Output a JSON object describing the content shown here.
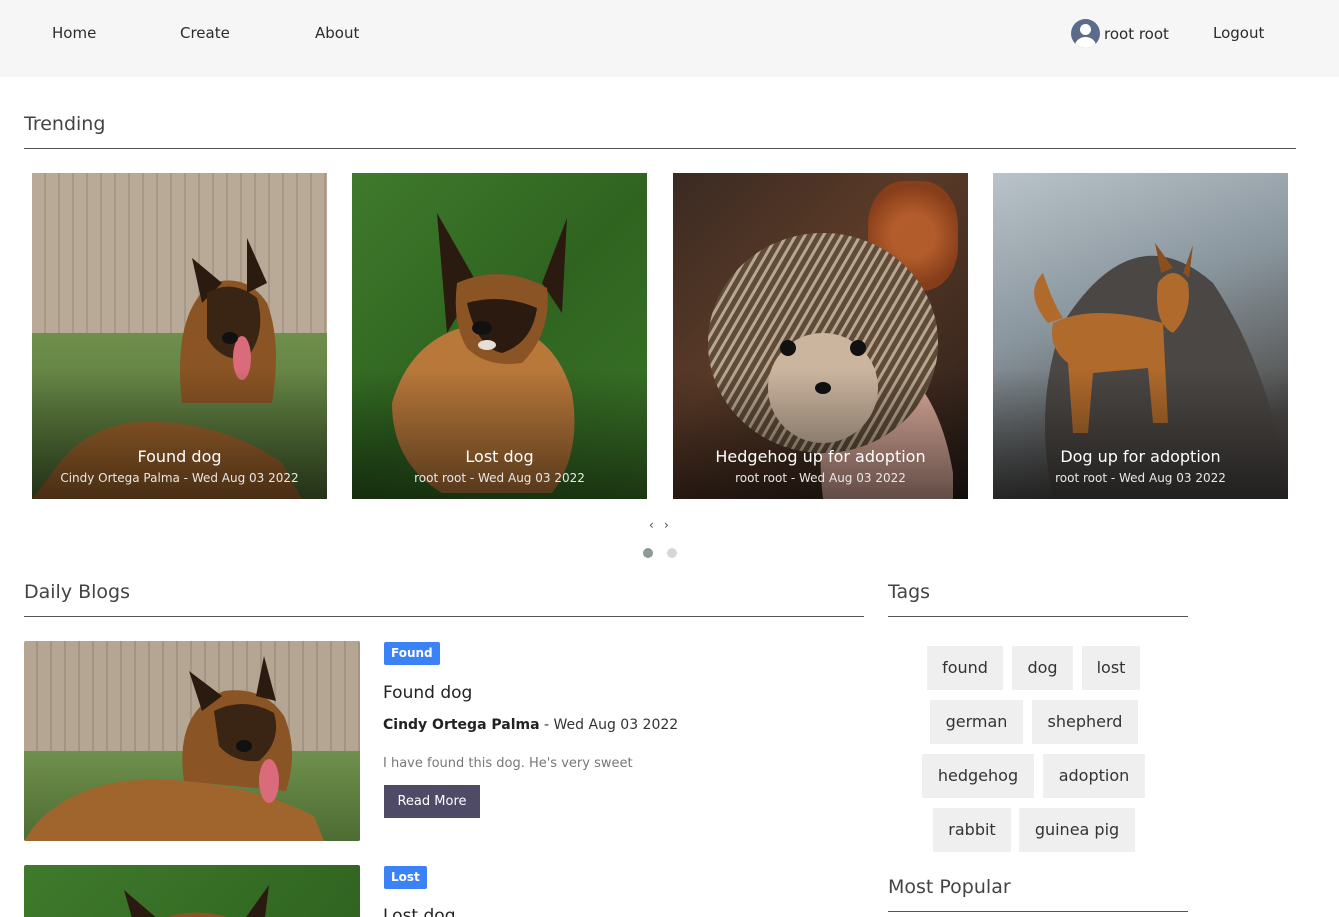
{
  "nav": {
    "home": "Home",
    "create": "Create",
    "about": "About",
    "username": "root root",
    "logout": "Logout"
  },
  "trending": {
    "title": "Trending",
    "cards": [
      {
        "title": "Found dog",
        "meta": "Cindy Ortega Palma - Wed Aug 03 2022"
      },
      {
        "title": "Lost dog",
        "meta": "root root - Wed Aug 03 2022"
      },
      {
        "title": "Hedgehog up for adoption",
        "meta": "root root - Wed Aug 03 2022"
      },
      {
        "title": "Dog up for adoption",
        "meta": "root root - Wed Aug 03 2022"
      }
    ],
    "prev": "‹",
    "next": "›"
  },
  "daily": {
    "title": "Daily Blogs",
    "posts": [
      {
        "badge": "Found",
        "title": "Found dog",
        "author": "Cindy Ortega Palma",
        "separator": " - ",
        "date": "Wed Aug 03 2022",
        "excerpt": "I have found this dog. He's very sweet",
        "read_more": "Read More"
      },
      {
        "badge": "Lost",
        "title": "Lost dog"
      }
    ]
  },
  "tags": {
    "title": "Tags",
    "items": [
      "found",
      "dog",
      "lost",
      "german",
      "shepherd",
      "hedgehog",
      "adoption",
      "rabbit",
      "guinea pig"
    ]
  },
  "popular": {
    "title": "Most Popular"
  },
  "colors": {
    "navbar_bg": "#f6f6f6",
    "badge": "#3b82f6",
    "read_more_bg": "#4f4b66",
    "tag_bg": "#efefef"
  }
}
